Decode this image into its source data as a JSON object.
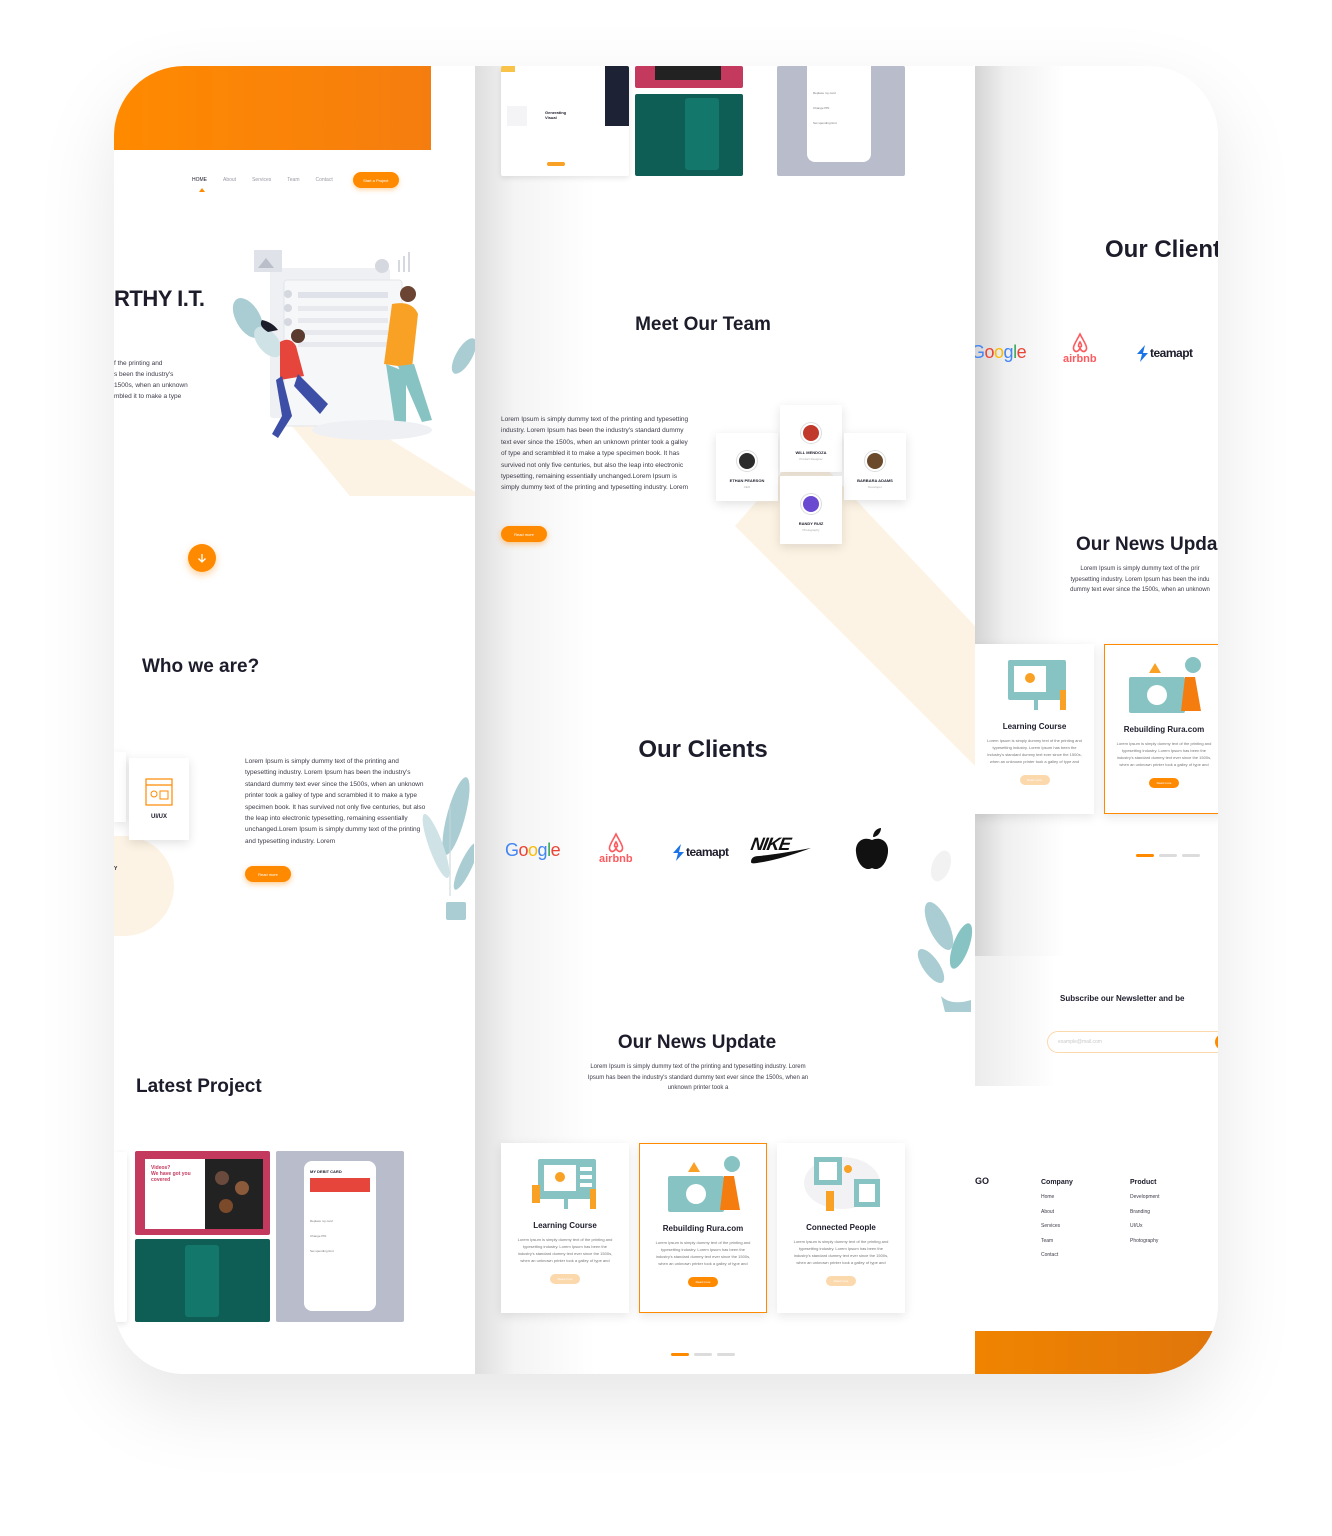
{
  "panel1": {
    "nav": {
      "home": "HOME",
      "about": "About",
      "services": "Services",
      "team": "Team",
      "contact": "Contact",
      "cta": "Start a Project"
    },
    "hero": {
      "title": "RTHY I.T.",
      "text": "f the printing and\ns been the industry's\n1500s, when an unknown\nmbled it to make a type"
    },
    "who": {
      "title": "Who we are?",
      "text": "Lorem Ipsum is simply dummy text of the printing and typesetting industry. Lorem Ipsum has been the industry's standard dummy text ever since the 1500s, when an unknown printer took a galley of type and scrambled it to make a type specimen book. It has survived not only five centuries, but also the leap into electronic typesetting, remaining essentially unchanged.Lorem Ipsum is simply dummy text of the printing and typesetting industry. Lorem",
      "button": "Read more",
      "service_label": "UI/UX",
      "side_label": "Y"
    },
    "latest": {
      "title": "Latest Project"
    },
    "project": {
      "card_headline": "Videos?\nWe have got you\ncovered",
      "debit_title": "MY DEBIT CARD",
      "rows": [
        "Replace my card",
        "Change PIN",
        "Set spending limit"
      ]
    }
  },
  "panel2": {
    "top_project": {
      "heading": "Generating\nVisual",
      "rows": [
        "Replace my card",
        "Change PIN",
        "Set spending limit"
      ]
    },
    "team": {
      "title": "Meet Our Team",
      "text": "Lorem Ipsum is simply dummy text of the printing and typesetting industry. Lorem Ipsum has been the industry's standard dummy text ever since the 1500s, when an unknown printer took a galley of type and scrambled it to make a type specimen book. It has survived not only five centuries, but also the leap into electronic typesetting, remaining essentially unchanged.Lorem Ipsum is simply dummy text of the printing and typesetting industry. Lorem",
      "button": "Read more",
      "members": [
        {
          "name": "ETHAN PEARSON",
          "role": "CEO"
        },
        {
          "name": "WILL MENDOZA",
          "role": "Product Designer"
        },
        {
          "name": "BARBARA ADAMS",
          "role": "Developer"
        },
        {
          "name": "RANDY RUIZ",
          "role": "Photography"
        }
      ]
    },
    "clients": {
      "title": "Our Clients",
      "logos": [
        "Google",
        "airbnb",
        "teamapt",
        "NIKE"
      ]
    },
    "news": {
      "title": "Our News Update",
      "text": "Lorem Ipsum is simply dummy text of the printing and typesetting industry. Lorem Ipsum has been the industry's standard dummy text ever since the 1500s, when an unknown printer took a",
      "cards": [
        {
          "title": "Learning Course",
          "text": "Lorem Ipsum is simply dummy text of the printing and typesetting industry. Lorem Ipsum has been the industry's standard dummy text ever since the 1500s, when an unknown printer took a galley of type and",
          "button": "Read more"
        },
        {
          "title": "Rebuilding Rura.com",
          "text": "Lorem Ipsum is simply dummy text of the printing and typesetting industry. Lorem Ipsum has been the industry's standard dummy text ever since the 1500s, when an unknown printer took a galley of type and",
          "button": "Read more"
        },
        {
          "title": "Connected People",
          "text": "Lorem Ipsum is simply dummy text of the printing and typesetting industry. Lorem Ipsum has been the industry's standard dummy text ever since the 1500s, when an unknown printer took a galley of type and",
          "button": "Read more"
        }
      ]
    }
  },
  "panel3": {
    "clients": {
      "title": "Our Client",
      "logos": [
        "Google",
        "airbnb",
        "teamapt"
      ]
    },
    "news": {
      "title": "Our News Upda",
      "text": "Lorem Ipsum is simply dummy text of the prir\ntypesetting industry. Lorem Ipsum has been the indu\ndummy text ever since the 1500s, when an unknown",
      "cards": [
        {
          "title": "Learning Course",
          "text": "Lorem Ipsum is simply dummy text of the printing and typesetting industry. Lorem Ipsum has been the industry's standard dummy text ever since the 1500s, when an unknown printer took a galley of type and",
          "button": "Read more"
        },
        {
          "title": "Rebuilding Rura.com",
          "text": "Lorem Ipsum is simply dummy text of the printing and typesetting industry. Lorem Ipsum has been the industry's standard dummy text ever since the 1500s, when an unknown printer took a galley of type and",
          "button": "Read more"
        }
      ]
    },
    "newsletter": {
      "title": "Subscribe our Newsletter and be",
      "placeholder": "example@mail.com"
    },
    "footer": {
      "logo": "GO",
      "company": {
        "heading": "Company",
        "links": [
          "Home",
          "About",
          "Services",
          "Team",
          "Contact"
        ]
      },
      "product": {
        "heading": "Product",
        "links": [
          "Development",
          "Branding",
          "UI/Ux",
          "Photography"
        ]
      }
    }
  },
  "colors": {
    "accent": "#ff8a00",
    "teal": "#0e5e55",
    "pink": "#c43a5f",
    "slate": "#b8bccb",
    "beige": "#fdf3e4"
  }
}
